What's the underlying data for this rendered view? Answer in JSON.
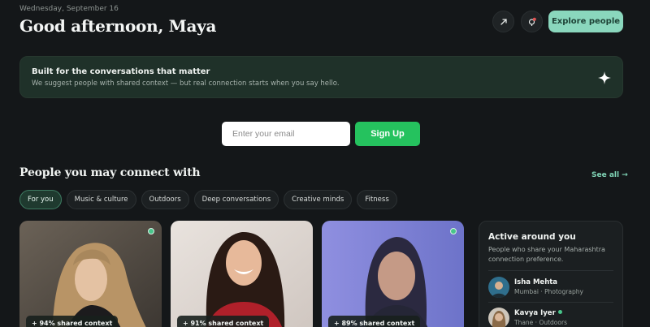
{
  "header": {
    "date": "Wednesday, September 16",
    "greeting": "Good afternoon, Maya",
    "explore_label": "Explore people",
    "icons": [
      "external-link-icon",
      "notification-icon"
    ]
  },
  "banner": {
    "title": "Built for the conversations that matter",
    "subtitle": "We suggest people with shared context — but real connection starts when you say hello.",
    "icon": "sparkle-icon"
  },
  "signup": {
    "email_placeholder": "Enter your email",
    "button_label": "Sign Up"
  },
  "section": {
    "title": "People you may connect with",
    "see_all": "See all →"
  },
  "chips": [
    "For you",
    "Music & culture",
    "Outdoors",
    "Deep conversations",
    "Creative minds",
    "Fitness"
  ],
  "cards": [
    {
      "match": "+ 94% shared context",
      "online": true
    },
    {
      "match": "+ 91% shared context",
      "online": false
    },
    {
      "match": "+ 89% shared context",
      "online": true
    }
  ],
  "active": {
    "title": "Active around you",
    "subtitle": "People who share your Maharashtra connection preference.",
    "people": [
      {
        "name": "Isha Mehta",
        "meta": "Mumbai · Photography",
        "online": false
      },
      {
        "name": "Kavya Iyer",
        "meta": "Thane · Outdoors",
        "online": true
      }
    ]
  },
  "colors": {
    "background": "#141719",
    "accent": "#8ad7bd",
    "signup": "#25c25e",
    "banner": "#1f3129"
  }
}
